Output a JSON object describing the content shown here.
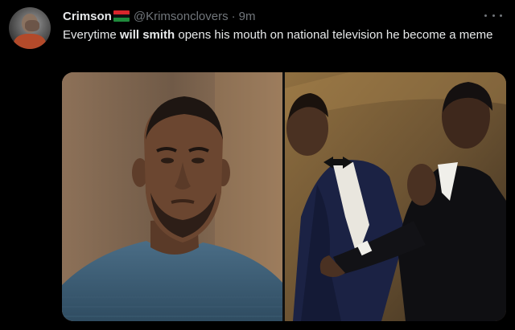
{
  "tweet": {
    "display_name": "Crimson",
    "handle": "@Krimsonclovers",
    "separator": "·",
    "time": "9m",
    "text_part1": "Everytime ",
    "text_bold": "will smith",
    "text_part2": " opens his mouth on national television he become a meme",
    "avatar_icon": "profile-avatar",
    "flag_icon": "flag-emoji",
    "more_icon": "more-options-icon"
  },
  "colors": {
    "background": "#000000",
    "text_primary": "#e7e9ea",
    "text_secondary": "#71767b"
  }
}
